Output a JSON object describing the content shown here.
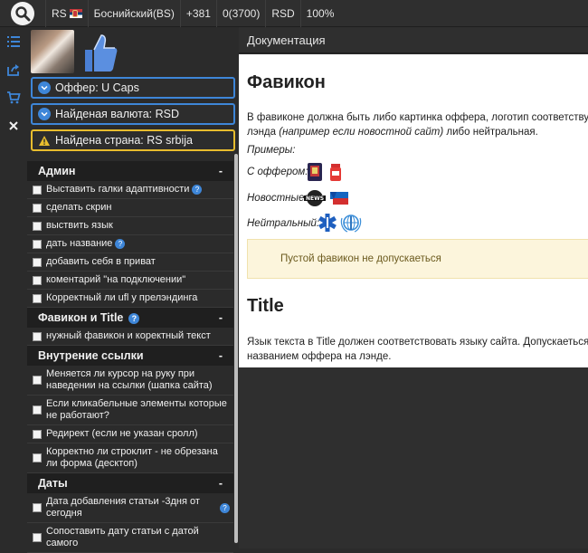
{
  "topbar": {
    "country": "RS",
    "language": "Боснийский(BS)",
    "phone_code": "+381",
    "counter": "0(3700)",
    "currency": "RSD",
    "zoom": "100%"
  },
  "rail": {
    "icons": [
      "list-icon",
      "share-icon",
      "cart-icon",
      "close-icon"
    ]
  },
  "panel": {
    "offer_box": {
      "label": "Оффер:",
      "value": "U Caps"
    },
    "currency_box": {
      "label": "Найденая валюта:",
      "value": "RSD"
    },
    "country_box": {
      "label": "Найдена страна:",
      "value": "RS",
      "extra": "srbija"
    }
  },
  "checklist": {
    "sections": [
      {
        "title": "Админ",
        "toggle": "-",
        "items": [
          {
            "text": "Выставить галки адаптивности",
            "help": "?"
          },
          {
            "text": "сделать скрин"
          },
          {
            "text": "выствить язык"
          },
          {
            "text": "дать название",
            "help": "?"
          },
          {
            "text": "добавить себя в приват"
          },
          {
            "text": "коментарий \"на подключении\""
          },
          {
            "text": "Корректный ли ufl у прелэндинга"
          }
        ]
      },
      {
        "title": "Фавикон и Title",
        "help": "?",
        "toggle": "-",
        "items": [
          {
            "text": "нужный фавикон и коректный текст"
          }
        ]
      },
      {
        "title": "Внутрение ссылки",
        "toggle": "-",
        "items": [
          {
            "text": "Меняется ли курсор на руку при наведении на ссылки (шапка сайта)"
          },
          {
            "text": "Если кликабельные элементы которые не работают?"
          },
          {
            "text": "Редирект (если не указан сролл)"
          },
          {
            "text": "Корректно ли строклит - не обрезана ли форма (десктоп)"
          }
        ]
      },
      {
        "title": "Даты",
        "toggle": "-",
        "items": [
          {
            "text": "Дата добавления статьи -3дня от сегодня",
            "help": "?"
          },
          {
            "text": "Сопоставить дату статьи с датой самого"
          }
        ]
      }
    ]
  },
  "doc": {
    "header": "Документация",
    "favicon_title": "Фавикон",
    "favicon_text_1": "В фавиконе должна быть либо картинка оффера, логотип соответствую",
    "favicon_text_2a": "лэнда ",
    "favicon_text_2b": "(например если новостной сайт)",
    "favicon_text_2c": " либо нейтральная.",
    "examples_label": "Примеры:",
    "with_offer_label": "С оффером:",
    "news_label": "Новостные:",
    "neutral_label": "Нейтральный:",
    "news_icon_text": "NEWS",
    "alert_text": "Пустой фавикон не допускаеться",
    "title_heading": "Title",
    "title_text_1": "Язык текста в Title должен соответствовать языку сайта. Допускаеться ti",
    "title_text_2": "названием оффера на лэнде."
  },
  "colors": {
    "accent_blue": "#3e86d8",
    "warning_yellow": "#e8bd2e",
    "panel_bg": "#2b2b2b",
    "section_bg": "#1f1f1f"
  }
}
